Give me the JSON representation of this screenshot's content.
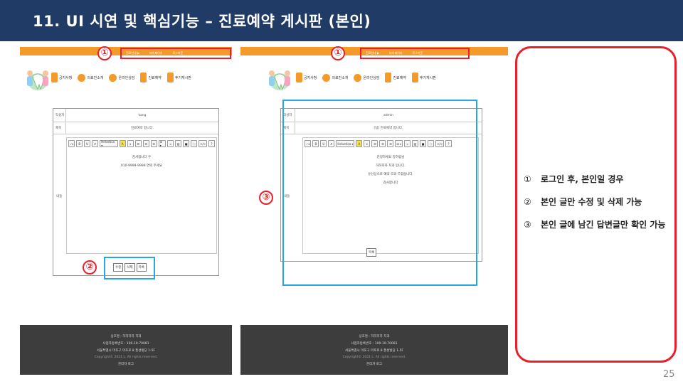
{
  "title": "11. UI 시연 및 핵심기능 – 진료예약 게시판 (본인)",
  "accent_color": "#e8202a",
  "highlight_color": "#29a5df",
  "brand_color": "#f39a2b",
  "header_color": "#1f3b66",
  "screenshots": [
    {
      "breadcrumb": [
        "진료안내 ▶",
        "마이페이지",
        "로그아웃"
      ],
      "badges": {
        "first": "①",
        "second": "②"
      },
      "nav": [
        "공지사항",
        "의료진소개",
        "온라인상담",
        "진료예약",
        "후기게시판"
      ],
      "form": {
        "author_label": "작성자",
        "author_value": "kang",
        "subject_label": "제목",
        "subject_value": "진료예약 합니다.",
        "content_label": "내용",
        "content_lines": [
          "감사합니다 우",
          "010-9999-9999 연락 주세요"
        ]
      },
      "toolbar": [
        "✓▾",
        "B",
        "U",
        "✗",
        "Helvetica ▾",
        "A",
        "▾",
        "☰",
        "☰",
        "☰",
        "⊞ ▾",
        "∞",
        "▨",
        "■",
        "⛶",
        "</>",
        "?"
      ],
      "buttons": [
        "수정",
        "삭제",
        "목록"
      ],
      "footer": [
        "상호명 : 하하하하 치과",
        "사업자등록번호 : 100-10-70081",
        "서울특별시 마포구 마포로 8 풍성빌딩 1-5F",
        "Copyright© 2021 L. All rights reserved.",
        "관리자 로그"
      ]
    },
    {
      "breadcrumb": [
        "진료안내 ▶",
        "마이페이지",
        "로그아웃"
      ],
      "badges": {
        "first": "①",
        "third": "③"
      },
      "nav": [
        "공지사항",
        "의료진소개",
        "온라인상담",
        "진료예약",
        "후기게시판"
      ],
      "form": {
        "author_label": "작성자",
        "author_value": "admin",
        "subject_label": "제목",
        "subject_value": "[답] 진료예약 합니다.",
        "content_label": "내용",
        "content_lines": [
          "안녕하세요 강하림님",
          "하하하하 치과 입니다.",
          "유선상으로 예약 도와 드렸습니다.",
          "감사합니다"
        ]
      },
      "toolbar": [
        "✓▾",
        "B",
        "U",
        "✗",
        "Helvetica ▾",
        "A",
        "▾",
        "☰",
        "☰",
        "☰",
        "⊞ ▾",
        "∞",
        "▨",
        "■",
        "⛶",
        "</>",
        "?"
      ],
      "buttons": [
        "목록"
      ],
      "footer": [
        "상호명 : 하하하하 치과",
        "사업자등록번호 : 100-10-70081",
        "서울특별시 마포구 마포로 8 풍성빌딩 1-5F",
        "Copyright© 2021 L. All rights reserved.",
        "관리자 로그"
      ]
    }
  ],
  "info": [
    {
      "num": "①",
      "text": "로그인 후, 본인일 경우"
    },
    {
      "num": "②",
      "text": "본인 글만 수정 및 삭제 가능"
    },
    {
      "num": "③",
      "text": "본인 글에 남긴 답변글만 확인 가능"
    }
  ],
  "page_number": "25"
}
